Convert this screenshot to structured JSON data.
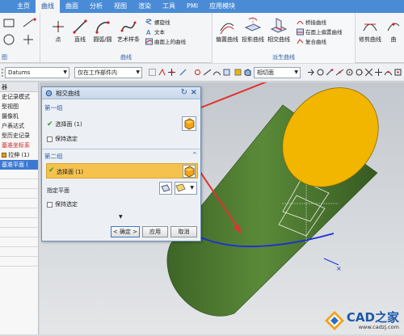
{
  "menu": {
    "items": [
      "主页",
      "曲线",
      "曲面",
      "分析",
      "视图",
      "渲染",
      "工具",
      "PMI",
      "应用模块"
    ],
    "active_index": 1
  },
  "ribbon": {
    "draw_group_label": "图",
    "curve_group": {
      "label": "曲线",
      "point": "点",
      "line": "直线",
      "arc": "圆弧/圆",
      "art_spline": "艺术样条",
      "helix": "螺旋线",
      "text": "文本",
      "curve_on_surface": "曲面上的曲线"
    },
    "derived_group": {
      "label": "派生曲线",
      "offset_curve": "偏置曲线",
      "project_curve": "投影曲线",
      "intersection_curve": "相交曲线",
      "bridge_curve": "桥接曲线",
      "offset_on_face": "在面上偏置曲线",
      "composite_curve": "复合曲线"
    },
    "edit_group": {
      "trim_curve": "修剪曲线",
      "extra": "曲"
    }
  },
  "toolbar": {
    "filter_value": "Datums",
    "scope_value": "仅在工作部件内",
    "view_value": "相切面"
  },
  "navigator": {
    "header": "器",
    "rows": [
      {
        "text": "史记录模式",
        "style": "normal"
      },
      {
        "text": "型视图",
        "style": "normal"
      },
      {
        "text": "摄像机",
        "style": "normal"
      },
      {
        "text": "户表达式",
        "style": "normal"
      },
      {
        "text": "型历史记录",
        "style": "normal"
      },
      {
        "text": "基准坐标系",
        "style": "red"
      },
      {
        "text": "拉伸 (1)",
        "style": "normal"
      },
      {
        "text": "基准平面 (",
        "style": "sel"
      }
    ]
  },
  "dialog": {
    "title": "相交曲线",
    "group1_title": "第一组",
    "group1_select": "选择面 (1)",
    "group1_keep": "保持选定",
    "group2_title": "第二组",
    "group2_select": "选择面 (1)",
    "group2_plane": "指定平面",
    "group2_keep": "保持选定",
    "ok": "< 确定 >",
    "apply": "应用",
    "cancel": "取消"
  },
  "watermark": {
    "logo": "CAD之家",
    "url": "www.cadzj.com"
  },
  "colors": {
    "menubar": "#4a8bd6",
    "cylinder": "#4f7a32",
    "cylinder_top": "#f2b500",
    "curve": "#1b2ed9",
    "arrow": "#e0332f",
    "selected_row": "#f4c24d"
  }
}
